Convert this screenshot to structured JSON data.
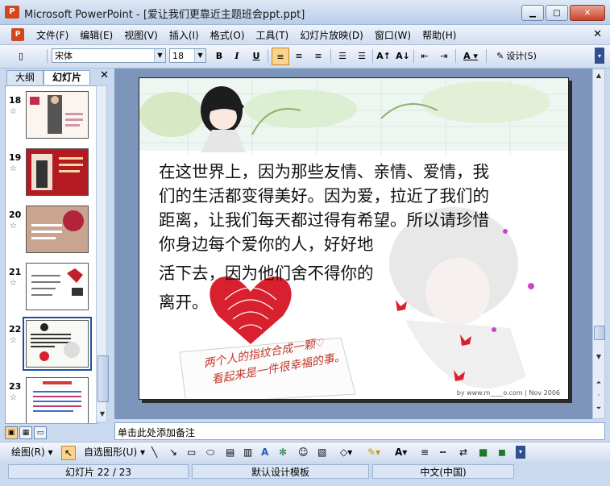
{
  "window": {
    "title": "Microsoft PowerPoint - [爱让我们更靠近主题班会ppt.ppt]",
    "app_icon": "powerpoint-icon"
  },
  "menubar": {
    "items": [
      "文件(F)",
      "编辑(E)",
      "视图(V)",
      "插入(I)",
      "格式(O)",
      "工具(T)",
      "幻灯片放映(D)",
      "窗口(W)",
      "帮助(H)"
    ]
  },
  "toolbar": {
    "font_name": "宋体",
    "font_size": "18",
    "bold": "B",
    "italic": "I",
    "underline": "U",
    "design_label": "设计(S)"
  },
  "left_pane": {
    "tabs": [
      "大纲",
      "幻灯片"
    ],
    "active_tab": "幻灯片",
    "slides": [
      {
        "num": "18",
        "star": "☆"
      },
      {
        "num": "19",
        "star": "☆"
      },
      {
        "num": "20",
        "star": "☆"
      },
      {
        "num": "21",
        "star": "☆"
      },
      {
        "num": "22",
        "star": "☆",
        "selected": true
      },
      {
        "num": "23",
        "star": "☆"
      }
    ]
  },
  "slide": {
    "text_lines": [
      "在这世界上，因为那些友情、亲情、爱情，我",
      "们的生活都变得美好。因为爱，拉近了我们的",
      "距离，让我们每天都过得有希望。所以请珍惜",
      "你身边每个爱你的人，好好地",
      "活下去，因为他们舍不得你的",
      "离开。"
    ],
    "handwriting_line1": "两个人的指纹合成一颗♡",
    "handwriting_line2": "看起来是一件很幸福的事。",
    "credit": "by www.m____o.com | Nov 2006",
    "heart_color": "#d8202e"
  },
  "notes": {
    "placeholder": "单击此处添加备注"
  },
  "drawing_toolbar": {
    "draw_label": "绘图(R)",
    "autoshapes_label": "自选图形(U)"
  },
  "statusbar": {
    "slide_position": "幻灯片 22 / 23",
    "template": "默认设计模板",
    "language": "中文(中国)"
  }
}
